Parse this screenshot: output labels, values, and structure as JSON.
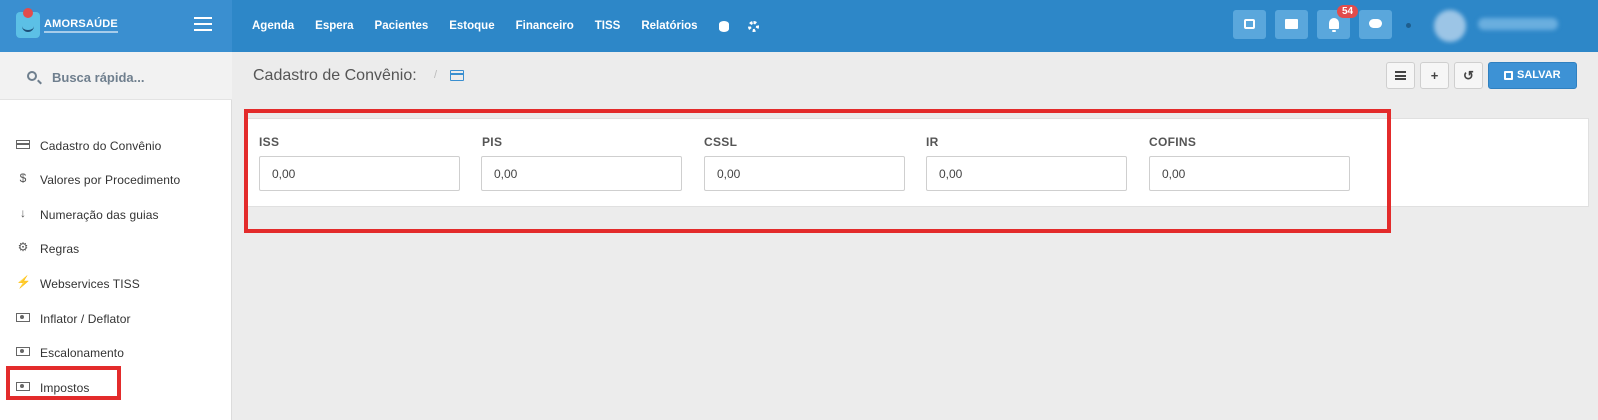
{
  "brand": {
    "name": "AMORSAÚDE"
  },
  "nav": {
    "items": [
      "Agenda",
      "Espera",
      "Pacientes",
      "Estoque",
      "Financeiro",
      "TISS",
      "Relatórios"
    ],
    "notification_count": "54"
  },
  "sidebar": {
    "search_placeholder": "Busca rápida...",
    "items": [
      {
        "label": "Cadastro do Convênio",
        "icon": "credit-card-icon"
      },
      {
        "label": "Valores por Procedimento",
        "icon": "dollar-icon"
      },
      {
        "label": "Numeração das guias",
        "icon": "sort-numeric-icon"
      },
      {
        "label": "Regras",
        "icon": "cogs-icon"
      },
      {
        "label": "Webservices TISS",
        "icon": "plug-icon"
      },
      {
        "label": "Inflator / Deflator",
        "icon": "money-icon"
      },
      {
        "label": "Escalonamento",
        "icon": "money-icon"
      },
      {
        "label": "Impostos",
        "icon": "money-icon"
      }
    ]
  },
  "header": {
    "title": "Cadastro de Convênio:",
    "separator": "/",
    "save_label": "SALVAR"
  },
  "taxes": {
    "fields": [
      {
        "label": "ISS",
        "value": "0,00"
      },
      {
        "label": "PIS",
        "value": "0,00"
      },
      {
        "label": "CSSL",
        "value": "0,00"
      },
      {
        "label": "IR",
        "value": "0,00"
      },
      {
        "label": "COFINS",
        "value": "0,00"
      }
    ]
  },
  "colors": {
    "topbar": "#2d87c8",
    "accent": "#3d92d5",
    "highlight": "#e32b2b",
    "badge": "#e24c4c"
  }
}
